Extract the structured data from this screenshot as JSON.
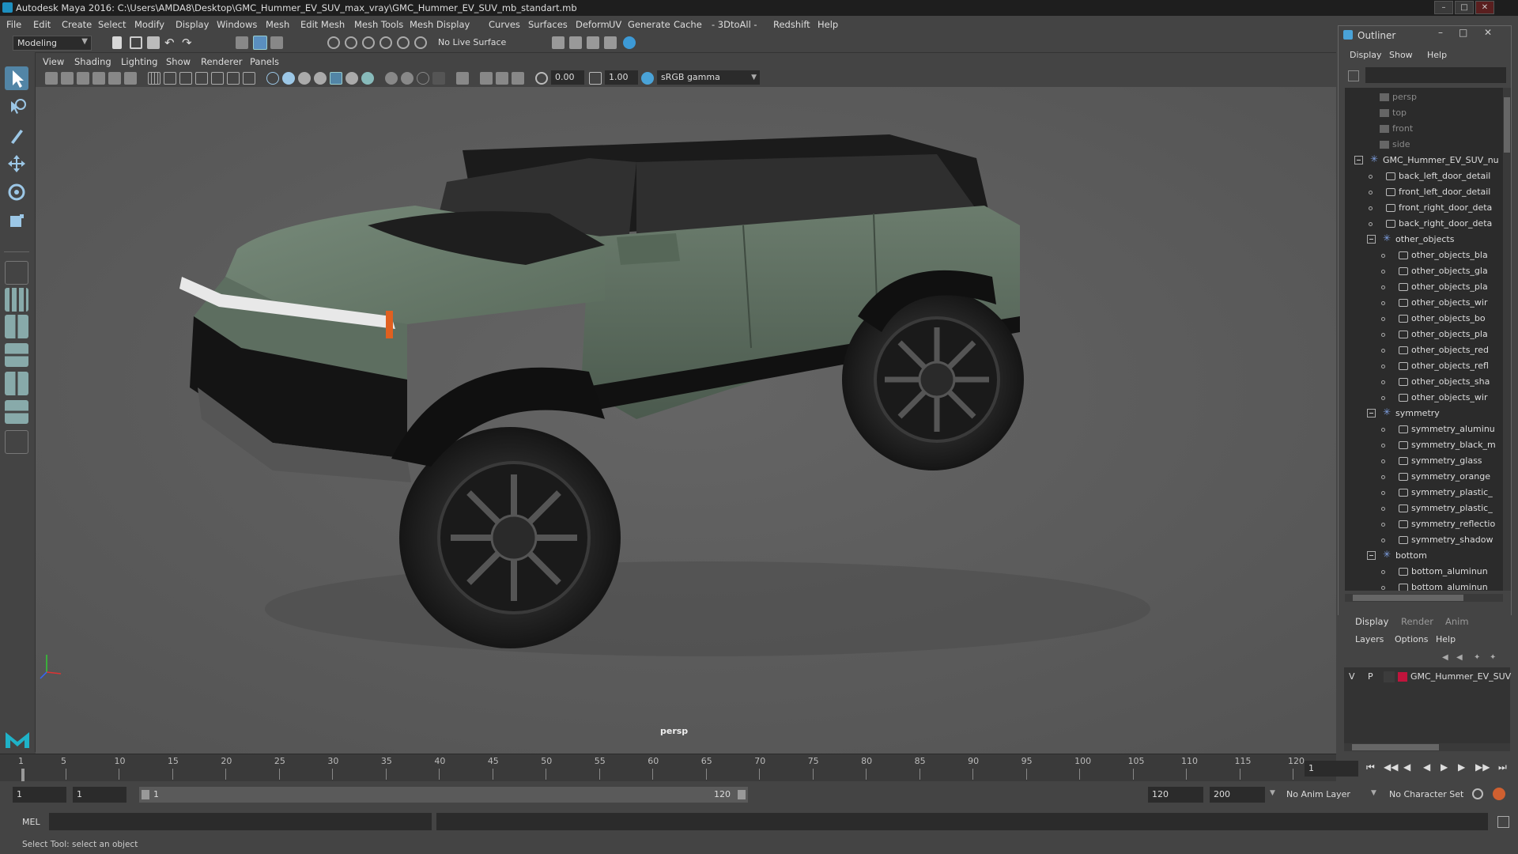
{
  "window": {
    "title": "Autodesk Maya 2016: C:\\Users\\AMDA8\\Desktop\\GMC_Hummer_EV_SUV_max_vray\\GMC_Hummer_EV_SUV_mb_standart.mb"
  },
  "menubar": {
    "items": [
      "File",
      "Edit",
      "Create",
      "Select",
      "Modify",
      "Display",
      "Windows",
      "Mesh",
      "Edit Mesh",
      "Mesh Tools",
      "Mesh Display",
      "Curves",
      "Surfaces",
      "Deform",
      "UV",
      "Generate",
      "Cache",
      "- 3DtoAll -",
      "Redshift",
      "Help"
    ]
  },
  "shelf": {
    "mode": "Modeling",
    "live_surface": "No Live Surface"
  },
  "panel": {
    "menus": [
      "View",
      "Shading",
      "Lighting",
      "Show",
      "Renderer",
      "Panels"
    ],
    "exposure": "0.00",
    "gamma": "1.00",
    "colorspace": "sRGB gamma",
    "camera_label": "persp"
  },
  "timeline": {
    "ticks": [
      "1",
      "5",
      "10",
      "15",
      "20",
      "25",
      "30",
      "35",
      "40",
      "45",
      "50",
      "55",
      "60",
      "65",
      "70",
      "75",
      "80",
      "85",
      "90",
      "95",
      "100",
      "105",
      "110",
      "115",
      "120"
    ],
    "current_frame": "1"
  },
  "range": {
    "start": "1",
    "start_inner": "1",
    "slider_start": "1",
    "slider_end": "120",
    "end_inner": "120",
    "end": "200",
    "anim_layer": "No Anim Layer",
    "character_set": "No Character Set"
  },
  "cmdline": {
    "label": "MEL"
  },
  "helpline": {
    "text": "Select Tool: select an object"
  },
  "outliner": {
    "title": "Outliner",
    "menus": [
      "Display",
      "Show",
      "Help"
    ],
    "rows": [
      {
        "label": "persp",
        "kind": "camera",
        "depth": 0
      },
      {
        "label": "top",
        "kind": "camera",
        "depth": 0
      },
      {
        "label": "front",
        "kind": "camera",
        "depth": 0
      },
      {
        "label": "side",
        "kind": "camera",
        "depth": 0
      },
      {
        "label": "GMC_Hummer_EV_SUV_nu",
        "kind": "group",
        "depth": 0
      },
      {
        "label": "back_left_door_detail",
        "kind": "mesh",
        "depth": 1
      },
      {
        "label": "front_left_door_detail",
        "kind": "mesh",
        "depth": 1
      },
      {
        "label": "front_right_door_deta",
        "kind": "mesh",
        "depth": 1
      },
      {
        "label": "back_right_door_deta",
        "kind": "mesh",
        "depth": 1
      },
      {
        "label": "other_objects",
        "kind": "group",
        "depth": 1
      },
      {
        "label": "other_objects_bla",
        "kind": "mesh",
        "depth": 2
      },
      {
        "label": "other_objects_gla",
        "kind": "mesh",
        "depth": 2
      },
      {
        "label": "other_objects_pla",
        "kind": "mesh",
        "depth": 2
      },
      {
        "label": "other_objects_wir",
        "kind": "mesh",
        "depth": 2
      },
      {
        "label": "other_objects_bo",
        "kind": "mesh",
        "depth": 2
      },
      {
        "label": "other_objects_pla",
        "kind": "mesh",
        "depth": 2
      },
      {
        "label": "other_objects_red",
        "kind": "mesh",
        "depth": 2
      },
      {
        "label": "other_objects_refl",
        "kind": "mesh",
        "depth": 2
      },
      {
        "label": "other_objects_sha",
        "kind": "mesh",
        "depth": 2
      },
      {
        "label": "other_objects_wir",
        "kind": "mesh",
        "depth": 2
      },
      {
        "label": "symmetry",
        "kind": "group",
        "depth": 1
      },
      {
        "label": "symmetry_aluminu",
        "kind": "mesh",
        "depth": 2
      },
      {
        "label": "symmetry_black_m",
        "kind": "mesh",
        "depth": 2
      },
      {
        "label": "symmetry_glass",
        "kind": "mesh",
        "depth": 2
      },
      {
        "label": "symmetry_orange",
        "kind": "mesh",
        "depth": 2
      },
      {
        "label": "symmetry_plastic_",
        "kind": "mesh",
        "depth": 2
      },
      {
        "label": "symmetry_plastic_",
        "kind": "mesh",
        "depth": 2
      },
      {
        "label": "symmetry_reflectio",
        "kind": "mesh",
        "depth": 2
      },
      {
        "label": "symmetry_shadow",
        "kind": "mesh",
        "depth": 2
      },
      {
        "label": "bottom",
        "kind": "group",
        "depth": 1
      },
      {
        "label": "bottom_aluminun",
        "kind": "mesh",
        "depth": 2
      },
      {
        "label": "bottom_aluminun",
        "kind": "mesh",
        "depth": 2
      }
    ]
  },
  "layers": {
    "tabs": [
      "Display",
      "Render",
      "Anim"
    ],
    "menus": [
      "Layers",
      "Options",
      "Help"
    ],
    "layer": {
      "v": "V",
      "p": "P",
      "name": "GMC_Hummer_EV_SUV",
      "color": "#c0143c"
    }
  },
  "colors": {
    "viewport_bg": "#5d5d5d",
    "car_body": "#5a6b5d",
    "accent_blue": "#4aa3d8"
  }
}
